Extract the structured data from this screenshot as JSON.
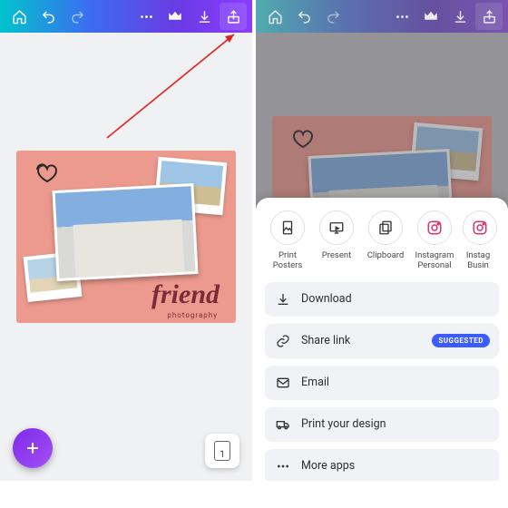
{
  "toolbar": {
    "home": "home-icon",
    "undo": "undo-icon",
    "redo": "redo-icon",
    "more": "more-icon",
    "crown": "crown-icon",
    "download": "download-icon",
    "share": "share-icon"
  },
  "design": {
    "main_text": "friend",
    "subtitle": "photography",
    "bg_color": "#ec9a8e"
  },
  "page_indicator": {
    "count": "1"
  },
  "share_targets": [
    {
      "id": "print-posters",
      "line1": "Print",
      "line2": "Posters"
    },
    {
      "id": "present",
      "line1": "Present",
      "line2": ""
    },
    {
      "id": "clipboard",
      "line1": "Clipboard",
      "line2": ""
    },
    {
      "id": "instagram-personal",
      "line1": "Instagram",
      "line2": "Personal"
    },
    {
      "id": "instagram-business",
      "line1": "Instag",
      "line2": "Busin"
    }
  ],
  "actions": {
    "download": "Download",
    "share_link": "Share link",
    "share_badge": "SUGGESTED",
    "email": "Email",
    "print": "Print your design",
    "more": "More apps"
  }
}
